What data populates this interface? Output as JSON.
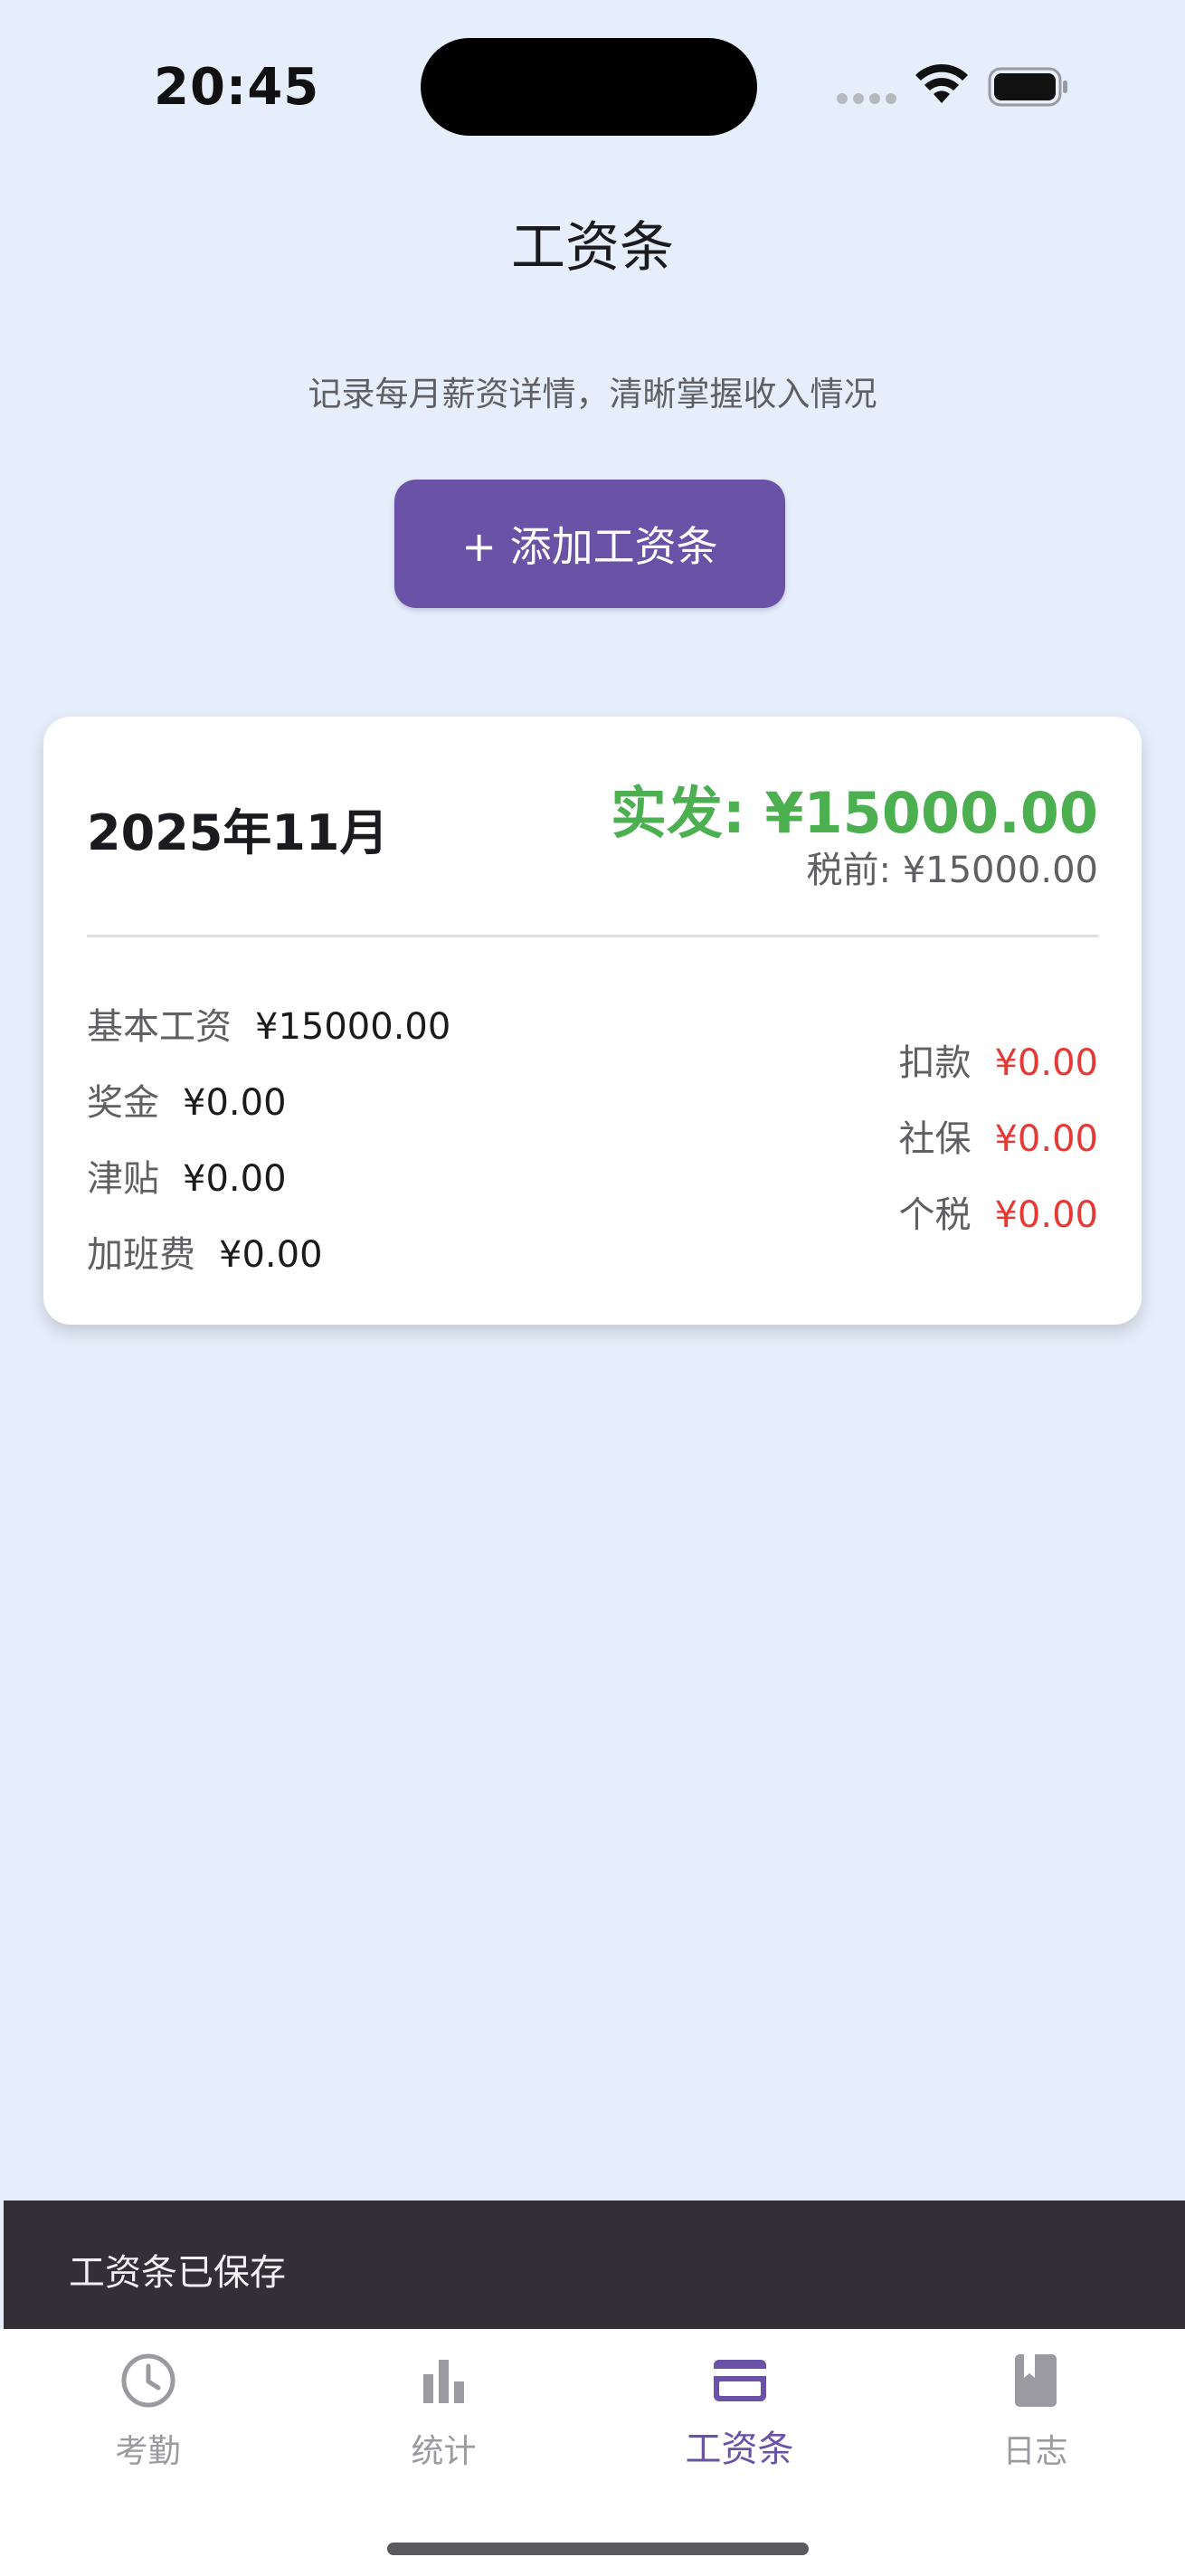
{
  "status_bar": {
    "time": "20:45",
    "wifi_icon": "wifi-icon",
    "battery_icon": "battery-icon"
  },
  "header": {
    "title": "工资条",
    "subtitle": "记录每月薪资详情，清晰掌握收入情况"
  },
  "add_button": {
    "label": "+ 添加工资条"
  },
  "payslip": {
    "month": "2025年11月",
    "net_pay": "实发: ¥15000.00",
    "pretax": "税前: ¥15000.00",
    "income": [
      {
        "label": "基本工资",
        "value": "¥15000.00"
      },
      {
        "label": "奖金",
        "value": "¥0.00"
      },
      {
        "label": "津贴",
        "value": "¥0.00"
      },
      {
        "label": "加班费",
        "value": "¥0.00"
      }
    ],
    "deductions": [
      {
        "label": "扣款",
        "value": "¥0.00"
      },
      {
        "label": "社保",
        "value": "¥0.00"
      },
      {
        "label": "个税",
        "value": "¥0.00"
      }
    ]
  },
  "snackbar": {
    "message": "工资条已保存"
  },
  "tabs": [
    {
      "label": "考勤",
      "icon": "clock-icon",
      "active": false
    },
    {
      "label": "统计",
      "icon": "bar-chart-icon",
      "active": false
    },
    {
      "label": "工资条",
      "icon": "credit-card-icon",
      "active": true
    },
    {
      "label": "日志",
      "icon": "book-icon",
      "active": false
    }
  ],
  "colors": {
    "background": "#e6eefb",
    "accent": "#6a52a6",
    "net_pay": "#4caf50",
    "deduction": "#e53935",
    "snackbar": "#323036"
  }
}
